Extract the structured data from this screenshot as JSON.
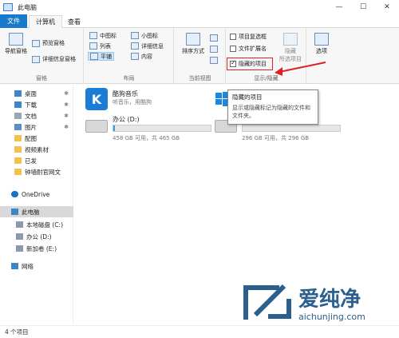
{
  "window": {
    "title": "此电脑",
    "min": "—",
    "max": "☐",
    "close": "✕"
  },
  "tabs": {
    "file": "文件",
    "computer": "计算机",
    "view": "查看"
  },
  "ribbon": {
    "pane": {
      "nav_pane": "导航窗格",
      "preview_pane": "预览窗格",
      "details_pane": "详细信息窗格",
      "label": "窗格"
    },
    "layout": {
      "options": [
        "中图标",
        "小图标",
        "列表",
        "详细信息",
        "平铺",
        "内容"
      ],
      "label": "布局"
    },
    "current_view": {
      "sort": "排序方式",
      "label": "当前视图"
    },
    "show_hide": {
      "item_checkbox": "项目复选框",
      "file_ext": "文件扩展名",
      "hidden_items": "隐藏的项目",
      "hide": "隐藏",
      "selected_items": "所选项目",
      "label": "显示/隐藏"
    },
    "options": {
      "label": "选项"
    }
  },
  "sidebar": {
    "items": [
      "桌面",
      "下载",
      "文档",
      "图片",
      "配图",
      "视频素材",
      "已发",
      "钟墙耐官网文",
      "OneDrive",
      "此电脑",
      "本地磁盘 (C:)",
      "办公 (D:)",
      "新加卷 (E:)",
      "网络"
    ]
  },
  "content": {
    "app_tile": {
      "title": "酷狗音乐",
      "sub": "听音乐，用酷狗"
    },
    "drive_d": {
      "title": "办公 (D:)",
      "free": "458 GB 可用，共 465 GB",
      "used_fraction": 0.015
    },
    "drive_e": {
      "free": "296 GB 可用，共 296 GB",
      "used_fraction": 0.0
    }
  },
  "tooltip": {
    "title": "隐藏的项目",
    "body": "显示或隐藏标记为隐藏的文件和文件夹。"
  },
  "status": {
    "count": "4 个项目"
  },
  "watermark": {
    "brand": "爱纯净",
    "url": "aichunjing.com"
  },
  "colors": {
    "accent": "#1979ca",
    "highlight": "#e02020",
    "drive_fill": "#26a0da"
  }
}
